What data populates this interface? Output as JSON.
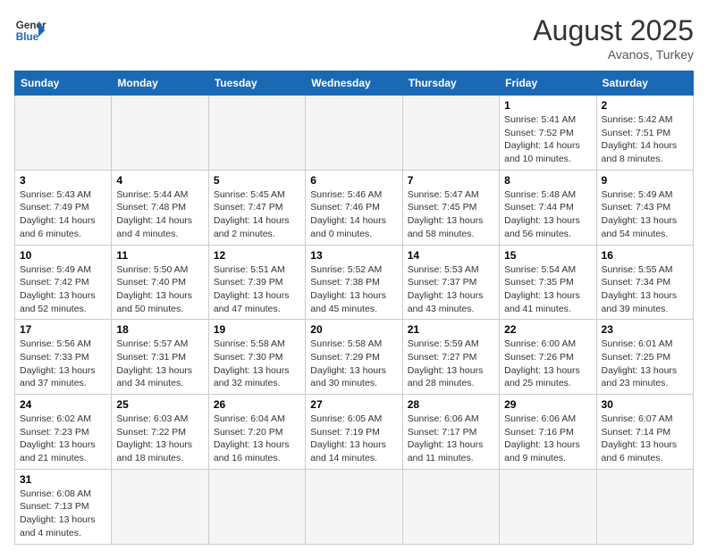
{
  "header": {
    "logo_general": "General",
    "logo_blue": "Blue",
    "month_year": "August 2025",
    "location": "Avanos, Turkey"
  },
  "weekdays": [
    "Sunday",
    "Monday",
    "Tuesday",
    "Wednesday",
    "Thursday",
    "Friday",
    "Saturday"
  ],
  "weeks": [
    [
      {
        "day": "",
        "info": ""
      },
      {
        "day": "",
        "info": ""
      },
      {
        "day": "",
        "info": ""
      },
      {
        "day": "",
        "info": ""
      },
      {
        "day": "",
        "info": ""
      },
      {
        "day": "1",
        "info": "Sunrise: 5:41 AM\nSunset: 7:52 PM\nDaylight: 14 hours and 10 minutes."
      },
      {
        "day": "2",
        "info": "Sunrise: 5:42 AM\nSunset: 7:51 PM\nDaylight: 14 hours and 8 minutes."
      }
    ],
    [
      {
        "day": "3",
        "info": "Sunrise: 5:43 AM\nSunset: 7:49 PM\nDaylight: 14 hours and 6 minutes."
      },
      {
        "day": "4",
        "info": "Sunrise: 5:44 AM\nSunset: 7:48 PM\nDaylight: 14 hours and 4 minutes."
      },
      {
        "day": "5",
        "info": "Sunrise: 5:45 AM\nSunset: 7:47 PM\nDaylight: 14 hours and 2 minutes."
      },
      {
        "day": "6",
        "info": "Sunrise: 5:46 AM\nSunset: 7:46 PM\nDaylight: 14 hours and 0 minutes."
      },
      {
        "day": "7",
        "info": "Sunrise: 5:47 AM\nSunset: 7:45 PM\nDaylight: 13 hours and 58 minutes."
      },
      {
        "day": "8",
        "info": "Sunrise: 5:48 AM\nSunset: 7:44 PM\nDaylight: 13 hours and 56 minutes."
      },
      {
        "day": "9",
        "info": "Sunrise: 5:49 AM\nSunset: 7:43 PM\nDaylight: 13 hours and 54 minutes."
      }
    ],
    [
      {
        "day": "10",
        "info": "Sunrise: 5:49 AM\nSunset: 7:42 PM\nDaylight: 13 hours and 52 minutes."
      },
      {
        "day": "11",
        "info": "Sunrise: 5:50 AM\nSunset: 7:40 PM\nDaylight: 13 hours and 50 minutes."
      },
      {
        "day": "12",
        "info": "Sunrise: 5:51 AM\nSunset: 7:39 PM\nDaylight: 13 hours and 47 minutes."
      },
      {
        "day": "13",
        "info": "Sunrise: 5:52 AM\nSunset: 7:38 PM\nDaylight: 13 hours and 45 minutes."
      },
      {
        "day": "14",
        "info": "Sunrise: 5:53 AM\nSunset: 7:37 PM\nDaylight: 13 hours and 43 minutes."
      },
      {
        "day": "15",
        "info": "Sunrise: 5:54 AM\nSunset: 7:35 PM\nDaylight: 13 hours and 41 minutes."
      },
      {
        "day": "16",
        "info": "Sunrise: 5:55 AM\nSunset: 7:34 PM\nDaylight: 13 hours and 39 minutes."
      }
    ],
    [
      {
        "day": "17",
        "info": "Sunrise: 5:56 AM\nSunset: 7:33 PM\nDaylight: 13 hours and 37 minutes."
      },
      {
        "day": "18",
        "info": "Sunrise: 5:57 AM\nSunset: 7:31 PM\nDaylight: 13 hours and 34 minutes."
      },
      {
        "day": "19",
        "info": "Sunrise: 5:58 AM\nSunset: 7:30 PM\nDaylight: 13 hours and 32 minutes."
      },
      {
        "day": "20",
        "info": "Sunrise: 5:58 AM\nSunset: 7:29 PM\nDaylight: 13 hours and 30 minutes."
      },
      {
        "day": "21",
        "info": "Sunrise: 5:59 AM\nSunset: 7:27 PM\nDaylight: 13 hours and 28 minutes."
      },
      {
        "day": "22",
        "info": "Sunrise: 6:00 AM\nSunset: 7:26 PM\nDaylight: 13 hours and 25 minutes."
      },
      {
        "day": "23",
        "info": "Sunrise: 6:01 AM\nSunset: 7:25 PM\nDaylight: 13 hours and 23 minutes."
      }
    ],
    [
      {
        "day": "24",
        "info": "Sunrise: 6:02 AM\nSunset: 7:23 PM\nDaylight: 13 hours and 21 minutes."
      },
      {
        "day": "25",
        "info": "Sunrise: 6:03 AM\nSunset: 7:22 PM\nDaylight: 13 hours and 18 minutes."
      },
      {
        "day": "26",
        "info": "Sunrise: 6:04 AM\nSunset: 7:20 PM\nDaylight: 13 hours and 16 minutes."
      },
      {
        "day": "27",
        "info": "Sunrise: 6:05 AM\nSunset: 7:19 PM\nDaylight: 13 hours and 14 minutes."
      },
      {
        "day": "28",
        "info": "Sunrise: 6:06 AM\nSunset: 7:17 PM\nDaylight: 13 hours and 11 minutes."
      },
      {
        "day": "29",
        "info": "Sunrise: 6:06 AM\nSunset: 7:16 PM\nDaylight: 13 hours and 9 minutes."
      },
      {
        "day": "30",
        "info": "Sunrise: 6:07 AM\nSunset: 7:14 PM\nDaylight: 13 hours and 6 minutes."
      }
    ],
    [
      {
        "day": "31",
        "info": "Sunrise: 6:08 AM\nSunset: 7:13 PM\nDaylight: 13 hours and 4 minutes."
      },
      {
        "day": "",
        "info": ""
      },
      {
        "day": "",
        "info": ""
      },
      {
        "day": "",
        "info": ""
      },
      {
        "day": "",
        "info": ""
      },
      {
        "day": "",
        "info": ""
      },
      {
        "day": "",
        "info": ""
      }
    ]
  ]
}
